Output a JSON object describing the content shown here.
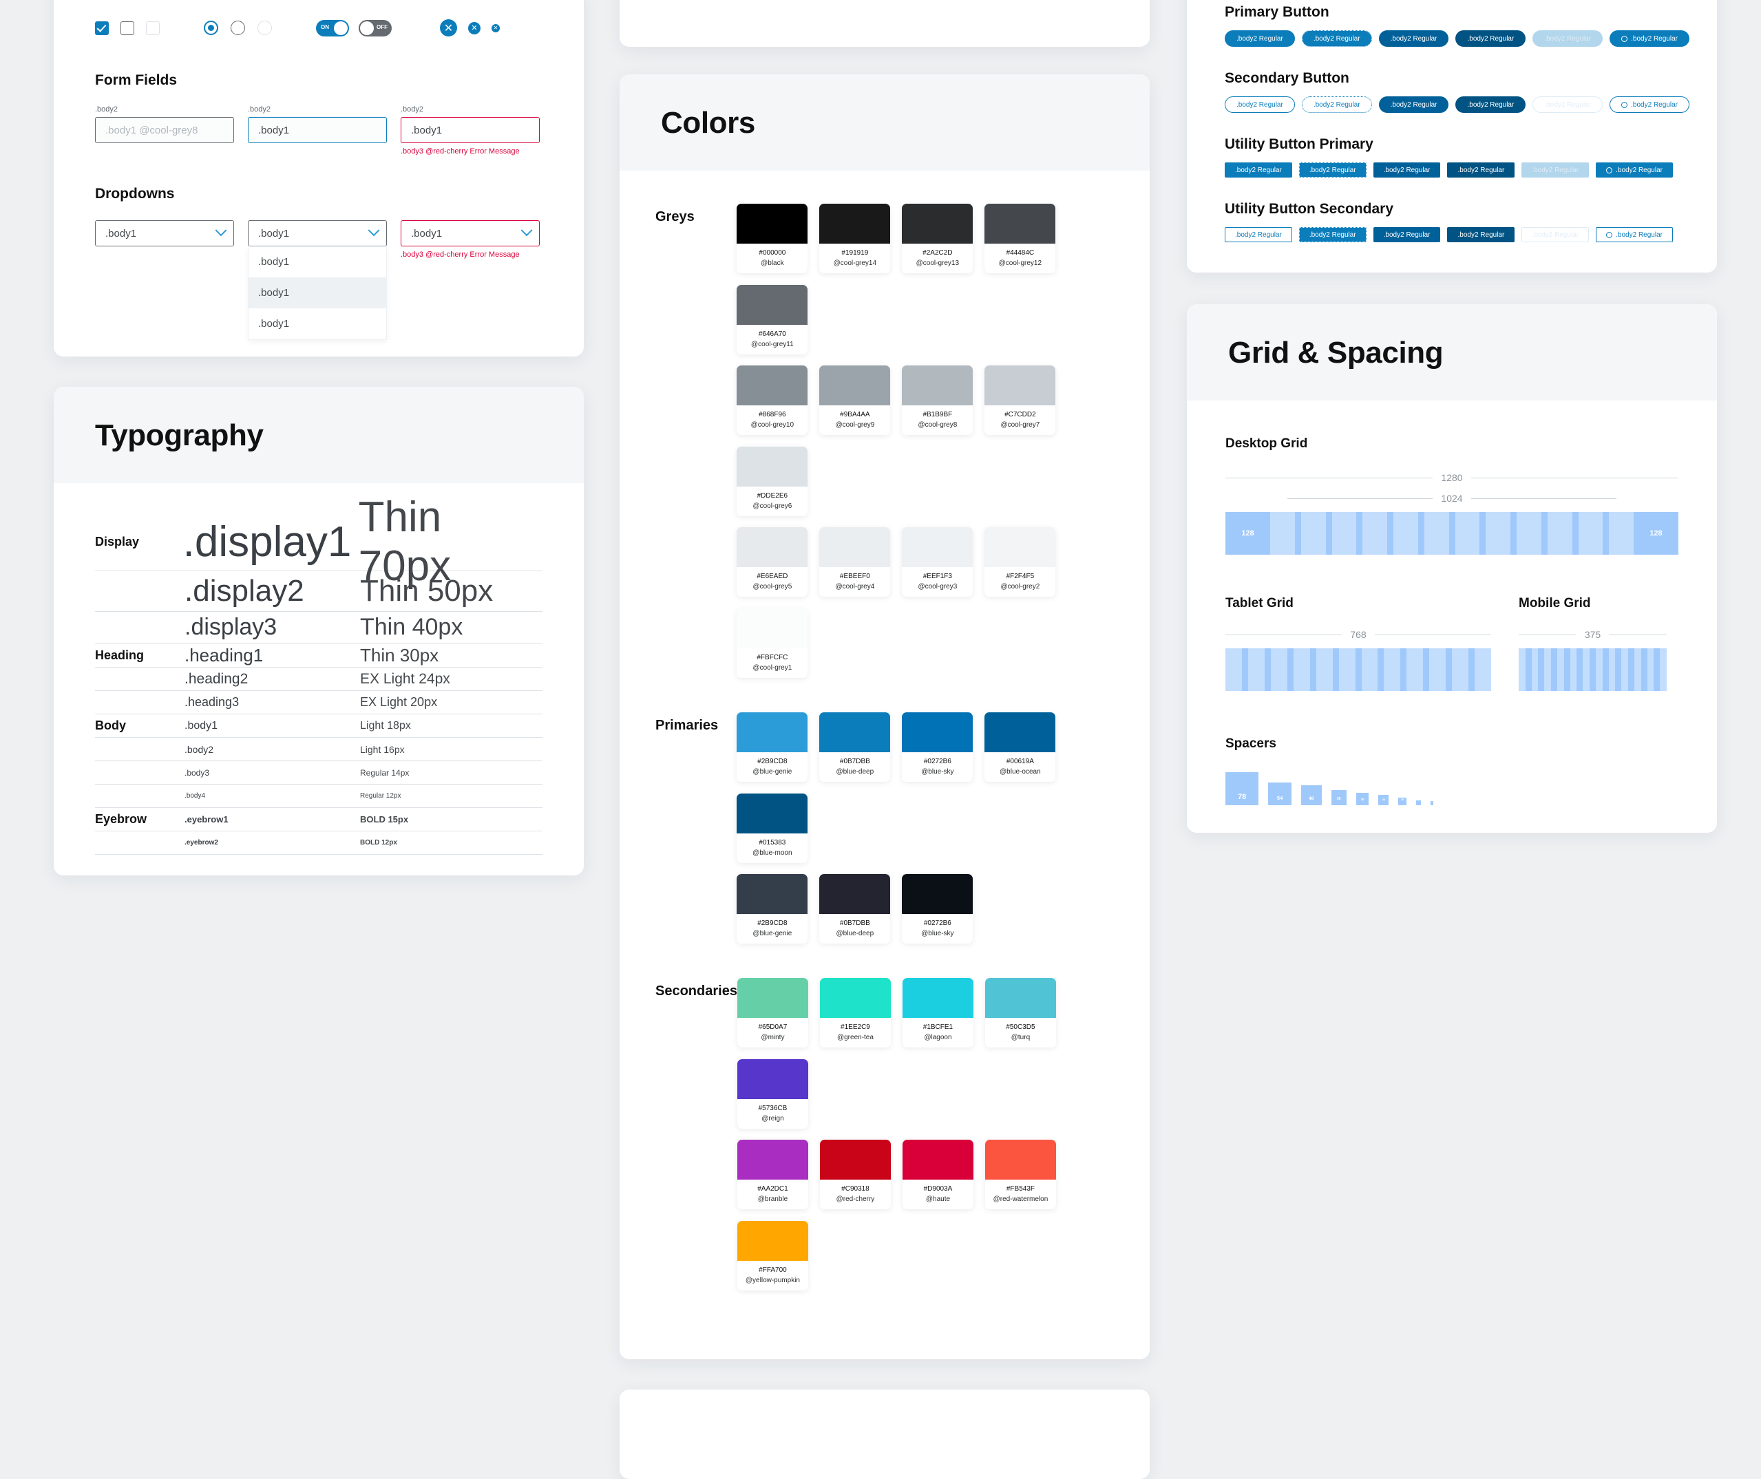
{
  "controls": {
    "checkboxes": [
      {
        "name": "checkbox-checked",
        "state": "checked"
      },
      {
        "name": "checkbox-empty",
        "state": "empty"
      },
      {
        "name": "checkbox-disabled",
        "state": "disabled"
      }
    ],
    "radios": [
      {
        "name": "radio-selected",
        "state": "on"
      },
      {
        "name": "radio-unselected",
        "state": "off"
      },
      {
        "name": "radio-disabled",
        "state": "dis"
      }
    ],
    "toggles": [
      {
        "name": "toggle-on",
        "label": "ON",
        "state": "on"
      },
      {
        "name": "toggle-off",
        "label": "OFF",
        "state": "off"
      }
    ],
    "close_icons": [
      {
        "name": "close-icon-large",
        "size": 24
      },
      {
        "name": "close-icon-medium",
        "size": 18
      },
      {
        "name": "close-icon-small",
        "size": 13
      }
    ]
  },
  "form_fields": {
    "title": "Form Fields",
    "fields": [
      {
        "label": ".body2",
        "value": ".body1 @cool-grey8",
        "state": "placeholder",
        "error": ""
      },
      {
        "label": ".body2",
        "value": ".body1",
        "state": "focused",
        "error": ""
      },
      {
        "label": ".body2",
        "value": ".body1",
        "state": "error",
        "error": ".body3 @red-cherry Error Message"
      }
    ]
  },
  "dropdowns": {
    "title": "Dropdowns",
    "items": [
      {
        "value": ".body1",
        "state": "norm",
        "error": "",
        "options": []
      },
      {
        "value": ".body1",
        "state": "open",
        "error": "",
        "options": [
          ".body1",
          ".body1",
          ".body1"
        ]
      },
      {
        "value": ".body1",
        "state": "err",
        "error": ".body3 @red-cherry Error Message",
        "options": []
      }
    ]
  },
  "typography": {
    "title": "Typography",
    "groups": [
      {
        "label": "Display",
        "rows": [
          {
            "name": ".display1",
            "spec": "Thin 70px",
            "size": 62,
            "weight": 200
          },
          {
            "name": ".display2",
            "spec": "Thin 50px",
            "size": 44,
            "weight": 200
          },
          {
            "name": ".display3",
            "spec": "Thin 40px",
            "size": 34,
            "weight": 200
          }
        ]
      },
      {
        "label": "Heading",
        "rows": [
          {
            "name": ".heading1",
            "spec": "Thin 30px",
            "size": 26,
            "weight": 200
          },
          {
            "name": ".heading2",
            "spec": "EX Light 24px",
            "size": 21,
            "weight": 300
          },
          {
            "name": ".heading3",
            "spec": "EX Light 20px",
            "size": 18,
            "weight": 300
          }
        ]
      },
      {
        "label": "Body",
        "rows": [
          {
            "name": ".body1",
            "spec": "Light 18px",
            "size": 16,
            "weight": 300
          },
          {
            "name": ".body2",
            "spec": "Light 16px",
            "size": 14,
            "weight": 300
          },
          {
            "name": ".body3",
            "spec": "Regular 14px",
            "size": 12,
            "weight": 400
          },
          {
            "name": ".body4",
            "spec": "Regular 12px",
            "size": 10,
            "weight": 400
          }
        ]
      },
      {
        "label": "Eyebrow",
        "rows": [
          {
            "name": ".eyebrow1",
            "spec": "BOLD 15px",
            "size": 13,
            "weight": 700
          },
          {
            "name": ".eyebrow2",
            "spec": "BOLD 12px",
            "size": 10,
            "weight": 700
          }
        ]
      }
    ]
  },
  "colors": {
    "title": "Colors",
    "sections": [
      {
        "label": "Greys",
        "rows": [
          [
            {
              "hex": "#000000",
              "token": "@black"
            },
            {
              "hex": "#191919",
              "token": "@cool-grey14"
            },
            {
              "hex": "#2A2C2D",
              "token": "@cool-grey13"
            },
            {
              "hex": "#44484C",
              "token": "@cool-grey12"
            },
            {
              "hex": "#646A70",
              "token": "@cool-grey11"
            }
          ],
          [
            {
              "hex": "#868F96",
              "token": "@cool-grey10"
            },
            {
              "hex": "#9BA4AA",
              "token": "@cool-grey9"
            },
            {
              "hex": "#B1B9BF",
              "token": "@cool-grey8"
            },
            {
              "hex": "#C7CDD2",
              "token": "@cool-grey7"
            },
            {
              "hex": "#DDE2E6",
              "token": "@cool-grey6"
            }
          ],
          [
            {
              "hex": "#E6EAED",
              "token": "@cool-grey5"
            },
            {
              "hex": "#EBEEF0",
              "token": "@cool-grey4"
            },
            {
              "hex": "#EEF1F3",
              "token": "@cool-grey3"
            },
            {
              "hex": "#F2F4F5",
              "token": "@cool-grey2"
            },
            {
              "hex": "#FBFCFC",
              "token": "@cool-grey1"
            }
          ]
        ]
      },
      {
        "label": "Primaries",
        "rows": [
          [
            {
              "hex": "#2B9CD8",
              "token": "@blue-genie"
            },
            {
              "hex": "#0B7DBB",
              "token": "@blue-deep"
            },
            {
              "hex": "#0272B6",
              "token": "@blue-sky"
            },
            {
              "hex": "#00619A",
              "token": "@blue-ocean"
            },
            {
              "hex": "#015383",
              "token": "@blue-moon"
            }
          ],
          [
            {
              "hex": "#343D4A",
              "token": "@blue-genie",
              "hexLabel": "#2B9CD8"
            },
            {
              "hex": "#23242F",
              "token": "@blue-deep",
              "hexLabel": "#0B7DBB"
            },
            {
              "hex": "#0B1017",
              "token": "@blue-sky",
              "hexLabel": "#0272B6"
            }
          ]
        ]
      },
      {
        "label": "Secondaries",
        "rows": [
          [
            {
              "hex": "#65D0A7",
              "token": "@minty"
            },
            {
              "hex": "#1EE2C9",
              "token": "@green-tea"
            },
            {
              "hex": "#1BCFE1",
              "token": "@lagoon"
            },
            {
              "hex": "#50C3D5",
              "token": "@turq"
            },
            {
              "hex": "#5736CB",
              "token": "@reign"
            }
          ],
          [
            {
              "hex": "#AA2DC1",
              "token": "@branble"
            },
            {
              "hex": "#C90318",
              "token": "@red-cherry"
            },
            {
              "hex": "#D9003A",
              "token": "@haute"
            },
            {
              "hex": "#FB543F",
              "token": "@red-watermelon"
            },
            {
              "hex": "#FFA700",
              "token": "@yellow-pumpkin"
            }
          ]
        ]
      }
    ]
  },
  "buttons": {
    "groups": [
      {
        "title": "Primary Button",
        "shape": "pill",
        "items": [
          {
            "label": ".body2 Regular",
            "style": "solid",
            "bg": "#0B7DBB",
            "fg": "#FFFFFF",
            "border": "none"
          },
          {
            "label": ".body2 Regular",
            "style": "focus",
            "bg": "#0B7DBB",
            "fg": "#FFFFFF",
            "border": "dotted"
          },
          {
            "label": ".body2 Regular",
            "style": "solid",
            "bg": "#00619A",
            "fg": "#FFFFFF",
            "border": "none"
          },
          {
            "label": ".body2 Regular",
            "style": "solid",
            "bg": "#015383",
            "fg": "#FFFFFF",
            "border": "none"
          },
          {
            "label": ".body2 Regular",
            "style": "disabled",
            "bg": "#B2D6EC",
            "fg": "#DDEBF6",
            "border": "none"
          },
          {
            "label": ".body2 Regular",
            "style": "loading",
            "bg": "#0B7DBB",
            "fg": "#FFFFFF",
            "border": "none"
          }
        ]
      },
      {
        "title": "Secondary Button",
        "shape": "pill",
        "items": [
          {
            "label": ".body2 Regular",
            "style": "outline",
            "bg": "#FFFFFF",
            "fg": "#0B7DBB",
            "border": "solid"
          },
          {
            "label": ".body2 Regular",
            "style": "focus-outline",
            "bg": "#FFFFFF",
            "fg": "#0B7DBB",
            "border": "dotted"
          },
          {
            "label": ".body2 Regular",
            "style": "solid",
            "bg": "#00619A",
            "fg": "#FFFFFF",
            "border": "none"
          },
          {
            "label": ".body2 Regular",
            "style": "solid",
            "bg": "#015383",
            "fg": "#FFFFFF",
            "border": "none"
          },
          {
            "label": ".body2 Regular",
            "style": "disabled-outline",
            "bg": "#FFFFFF",
            "fg": "#E6EFF7",
            "border": "light"
          },
          {
            "label": ".body2 Regular",
            "style": "loading-outline",
            "bg": "#FFFFFF",
            "fg": "#0B7DBB",
            "border": "solid"
          }
        ]
      },
      {
        "title": "Utility Button Primary",
        "shape": "rect",
        "items": [
          {
            "label": ".body2 Regular",
            "style": "solid",
            "bg": "#0B7DBB",
            "fg": "#FFFFFF",
            "border": "none"
          },
          {
            "label": ".body2 Regular",
            "style": "focus",
            "bg": "#0B7DBB",
            "fg": "#FFFFFF",
            "border": "dotted"
          },
          {
            "label": ".body2 Regular",
            "style": "solid",
            "bg": "#00619A",
            "fg": "#FFFFFF",
            "border": "none"
          },
          {
            "label": ".body2 Regular",
            "style": "solid",
            "bg": "#015383",
            "fg": "#FFFFFF",
            "border": "none"
          },
          {
            "label": ".body2 Regular",
            "style": "disabled",
            "bg": "#B2D6EC",
            "fg": "#DDEBF6",
            "border": "none"
          },
          {
            "label": ".body2 Regular",
            "style": "loading",
            "bg": "#0B7DBB",
            "fg": "#FFFFFF",
            "border": "none"
          }
        ]
      },
      {
        "title": "Utility Button Secondary",
        "shape": "rect",
        "items": [
          {
            "label": ".body2 Regular",
            "style": "outline",
            "bg": "#FFFFFF",
            "fg": "#0B7DBB",
            "border": "solid"
          },
          {
            "label": ".body2 Regular",
            "style": "focus-outline",
            "bg": "#0B7DBB",
            "fg": "#FFFFFF",
            "border": "dotted"
          },
          {
            "label": ".body2 Regular",
            "style": "solid",
            "bg": "#00619A",
            "fg": "#FFFFFF",
            "border": "none"
          },
          {
            "label": ".body2 Regular",
            "style": "solid",
            "bg": "#015383",
            "fg": "#FFFFFF",
            "border": "none"
          },
          {
            "label": ".body2 Regular",
            "style": "disabled-outline",
            "bg": "#FFFFFF",
            "fg": "#E6EFF7",
            "border": "light"
          },
          {
            "label": ".body2 Regular",
            "style": "loading-outline",
            "bg": "#FFFFFF",
            "fg": "#0B7DBB",
            "border": "solid"
          }
        ]
      }
    ]
  },
  "grid": {
    "title": "Grid & Spacing",
    "desktop": {
      "label": "Desktop Grid",
      "outer_width": "1280",
      "inner_width": "1024",
      "margin_label": "128",
      "columns": 12
    },
    "tablet": {
      "label": "Tablet Grid",
      "width": "768",
      "columns": 12
    },
    "mobile": {
      "label": "Mobile Grid",
      "width": "375",
      "columns": 12
    },
    "spacers": {
      "label": "Spacers",
      "values": [
        "78",
        "54",
        "48",
        "36",
        "30",
        "24",
        "18",
        "12",
        "6"
      ]
    }
  }
}
